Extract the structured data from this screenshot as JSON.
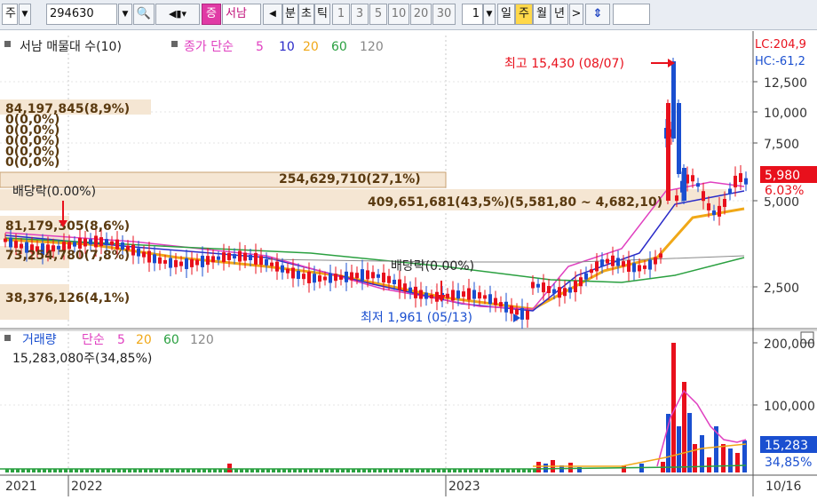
{
  "toolbar": {
    "market": "주",
    "code": "294630",
    "name_badge": "증",
    "name": "서남",
    "period_label": "분",
    "tick_labels": [
      "초",
      "틱"
    ],
    "numbers": [
      "1",
      "3",
      "5",
      "10",
      "20",
      "30"
    ],
    "count": "1",
    "day": "일",
    "week": "주",
    "month": "월",
    "year": "년",
    "next": ">",
    "updown": "⇕"
  },
  "legend": {
    "title": "서남 매물대 수(10)",
    "ma_label": "종가 단순",
    "ma_periods": [
      "5",
      "10",
      "20",
      "60",
      "120"
    ],
    "lc": "LC:204,9",
    "hc": "HC:-61,2"
  },
  "labels": {
    "high": "최고 15,430 (08/07)",
    "low": "최저 1,961 (05/13)",
    "div1": "배당락(0.00%)",
    "div2": "배당락(0.00%)",
    "price_badge": "5,980",
    "pct_badge": "6.03%"
  },
  "volume_profile": [
    "84,197,845(8,9%)",
    "0(0,0%)",
    "0(0,0%)",
    "0(0,0%)",
    "0(0,0%)",
    "0(0,0%)",
    "254,629,710(27,1%)",
    "409,651,681(43,5%)(5,581,80 ~ 4,682,10)",
    "81,179,305(8,6%)",
    "73,254,780(7,8%)",
    "38,376,126(4,1%)"
  ],
  "price_axis": [
    "12,500",
    "10,000",
    "7,500",
    "5,000",
    "2,500"
  ],
  "volume_legend": {
    "title": "거래량",
    "ma_label": "단순",
    "periods": [
      "5",
      "20",
      "60",
      "120"
    ],
    "value": "15,283,080주(34,85%)"
  },
  "volume_axis": [
    "200,000",
    "100,000"
  ],
  "volume_badges": [
    "15,283",
    "34,85%"
  ],
  "x_axis": [
    "2021",
    "2022",
    "2023",
    "10/16"
  ],
  "colors": {
    "up": "#e8101c",
    "down": "#1a4fd0",
    "ma5": "#e040c0",
    "ma10": "#2a2ac8",
    "ma20": "#f0a818",
    "ma60": "#2aa040",
    "ma120": "#8a8a8a",
    "vp": "#f5e6d3",
    "vpText": "#5a3a10"
  }
}
